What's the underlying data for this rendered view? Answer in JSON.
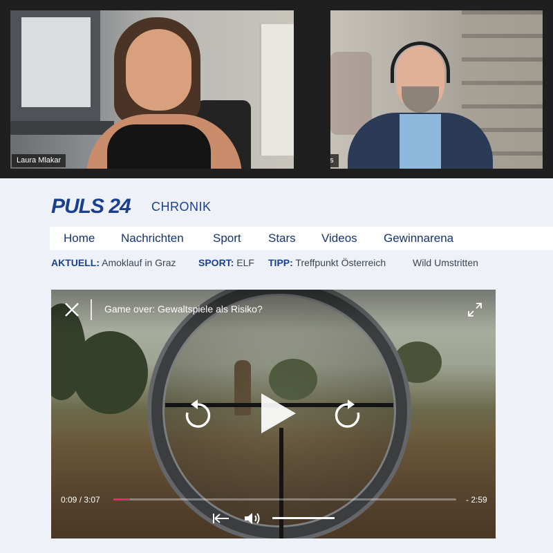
{
  "call": {
    "participants": [
      {
        "name": "Laura Mlakar"
      },
      {
        "name": "John Haas"
      }
    ]
  },
  "site": {
    "logo": "PULS 24",
    "section": "CHRONIK",
    "brand_color": "#1a3f8f",
    "nav": [
      "Home",
      "Nachrichten",
      "Sport",
      "Stars",
      "Videos",
      "Gewinnarena"
    ],
    "ticker": [
      {
        "key": "AKTUELL:",
        "value": "Amoklauf in Graz"
      },
      {
        "key": "SPORT:",
        "value": "ELF"
      },
      {
        "key": "TIPP:",
        "value": "Treffpunkt Österreich"
      },
      {
        "key": "",
        "value": "Wild Umstritten"
      }
    ]
  },
  "player": {
    "title": "Game over: Gewaltspiele als Risiko?",
    "current_time": "0:09 / 3:07",
    "remaining_time": "- 2:59",
    "progress_fraction": 0.048,
    "volume_fraction": 1.0,
    "accent_color": "#d63367",
    "icons": [
      "close-icon",
      "fullscreen-icon",
      "rewind-icon",
      "play-icon",
      "forward-icon",
      "skip-back-icon",
      "volume-icon"
    ]
  }
}
